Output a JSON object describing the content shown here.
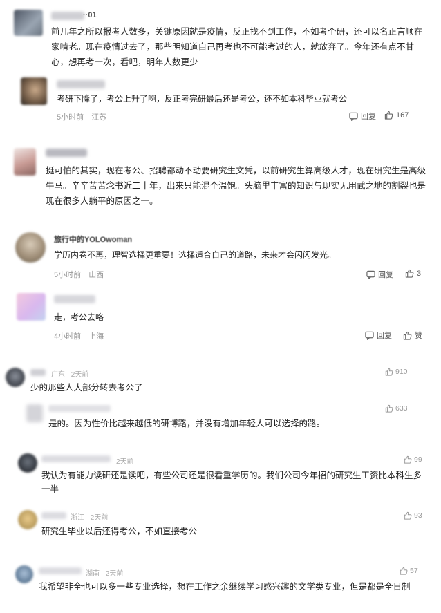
{
  "colors": {
    "meta_gray": "#999999",
    "icon_gray": "#666666",
    "text": "#222222"
  },
  "comments": [
    {
      "id": "c1",
      "username_visible": "··01",
      "text": "前几年之所以报考人数多，关键原因就是疫情，反正找不到工作，不如考个研，还可以名正言顺在家啃老。现在疫情过去了，那些明知道自己再考也不可能考过的人，就放弃了。今年还有点不甘心，想再考一次，看吧，明年人数更少",
      "reply": {
        "text": "考研下降了，考公上升了啊，反正考完研最后还是考公，还不如本科毕业就考公",
        "time": "5小时前",
        "location": "江苏",
        "reply_label": "回复",
        "likes": "167"
      }
    },
    {
      "id": "c2",
      "text": "挺可怕的其实，现在考公、招聘都动不动要研究生文凭，以前研究生算高级人才，现在研究生是高级牛马。辛辛苦苦念书近二十年，出来只能混个温饱。头脑里丰富的知识与现实无用武之地的割裂也是现在很多人躺平的原因之一。"
    },
    {
      "id": "c3",
      "username": "旅行中的YOLOwoman",
      "text": "学历内卷不再，理智选择更重要！选择适合自己的道路，未来才会闪闪发光。",
      "time": "5小时前",
      "location": "山西",
      "reply_label": "回复",
      "likes": "3"
    },
    {
      "id": "c4",
      "text": "走，考公去咯",
      "time": "4小时前",
      "location": "上海",
      "reply_label": "回复",
      "likes": "赞"
    }
  ],
  "bottom_comments": [
    {
      "id": "b1",
      "location": "广东",
      "time": "2天前",
      "likes": "910",
      "text": "少的那些人大部分转去考公了"
    },
    {
      "id": "b2",
      "likes": "633",
      "text": "是的。因为性价比越来越低的研博路，并没有增加年轻人可以选择的路。"
    },
    {
      "id": "b3",
      "time": "2天前",
      "likes": "99",
      "text": "我认为有能力读研还是读吧，有些公司还是很看重学历的。我们公司今年招的研究生工资比本科生多一半"
    },
    {
      "id": "b4",
      "location": "浙江",
      "time": "2天前",
      "likes": "93",
      "text": "研究生毕业以后还得考公，不如直接考公"
    },
    {
      "id": "b5",
      "location": "湖南",
      "time": "2天前",
      "likes": "57",
      "text": "我希望非全也可以多一些专业选择，想在工作之余继续学习感兴趣的文学类专业，但是都是全日制"
    }
  ],
  "icons": [
    "comment-icon",
    "thumbs-up-icon"
  ]
}
